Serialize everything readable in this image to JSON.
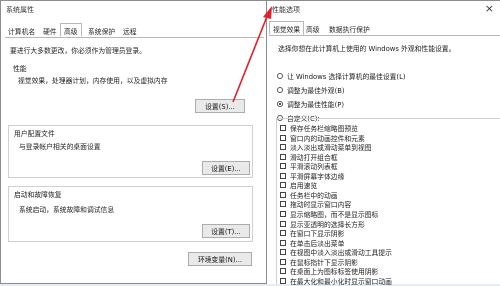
{
  "left_window": {
    "title": "系统属性",
    "tabs": [
      "计算机名",
      "硬件",
      "高级",
      "系统保护",
      "远程"
    ],
    "admin_note": "要进行大多数更改，你必须作为管理员登录。",
    "performance": {
      "label": "性能",
      "desc": "视觉效果，处理器计划，内存使用，以及虚拟内存",
      "button": "设置(S)..."
    },
    "user_profiles": {
      "label": "用户配置文件",
      "desc": "与登录帐户相关的桌面设置",
      "button": "设置(E)..."
    },
    "startup": {
      "label": "启动和故障恢复",
      "desc": "系统启动，系统故障和调试信息",
      "button": "设置(T)..."
    },
    "env_button": "环境变量(N)..."
  },
  "right_window": {
    "title": "性能选项",
    "close_glyph": "×",
    "tabs": [
      "视觉效果",
      "高级",
      "数据执行保护"
    ],
    "instruction": "选择你想在此计算机上使用的 Windows 外观和性能设置。",
    "radios": [
      {
        "label": "让 Windows 选择计算机的最佳设置(L)",
        "selected": false
      },
      {
        "label": "调整为最佳外观(B)",
        "selected": false
      },
      {
        "label": "调整为最佳性能(P)",
        "selected": true
      },
      {
        "label": "自定义(C):",
        "selected": false
      }
    ],
    "checkboxes": [
      "保存任务栏缩略图预览",
      "窗口内的动画控件和元素",
      "淡入淡出或滑动菜单到视图",
      "滑动打开组合框",
      "平滑滚动列表框",
      "平滑屏幕字体边缘",
      "启用速览",
      "任务栏中的动画",
      "拖动时显示窗口内容",
      "显示缩略图，而不是显示图标",
      "显示亚透明的选择长方形",
      "在窗口下显示阴影",
      "在单击后淡出菜单",
      "在视图中淡入淡出或滑动工具提示",
      "在鼠标指针下显示阴影",
      "在桌面上为图标标签使用阴影",
      "在最大化和最小化时显示窗口动画"
    ]
  },
  "colors": {
    "arrow": "#e0202a"
  }
}
